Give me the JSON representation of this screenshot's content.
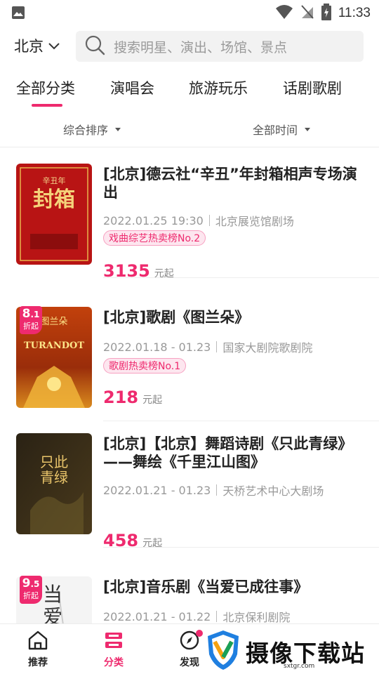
{
  "status_bar": {
    "time": "11:33"
  },
  "header": {
    "city": "北京",
    "search_placeholder": "搜索明星、演出、场馆、景点"
  },
  "tabs": [
    {
      "label": "全部分类",
      "active": true
    },
    {
      "label": "演唱会"
    },
    {
      "label": "旅游玩乐"
    },
    {
      "label": "话剧歌剧"
    }
  ],
  "filters": {
    "sort": "综合排序",
    "time": "全部时间"
  },
  "events": [
    {
      "title": "[北京]德云社“辛丑”年封箱相声专场演出",
      "date": "2022.01.25 19:30",
      "venue": "北京展览馆剧场",
      "tag": "戏曲综艺热卖榜No.2",
      "price": "3135",
      "price_unit": "元起",
      "poster_text": "封箱",
      "poster_sub": "辛丑年"
    },
    {
      "title": "[北京]歌剧《图兰朵》",
      "date": "2022.01.18 - 01.23",
      "venue": "国家大剧院歌剧院",
      "tag": "歌剧热卖榜No.1",
      "price": "218",
      "price_unit": "元起",
      "discount_int": "8",
      "discount_dec": ".1",
      "discount_label": "折起",
      "poster_text": "TURANDOT",
      "poster_sub": "图兰朵"
    },
    {
      "title": "[北京]【北京】舞蹈诗剧《只此青绿》——舞绘《千里江山图》",
      "date": "2022.01.21 - 01.23",
      "venue": "天桥艺术中心大剧场",
      "price": "458",
      "price_unit": "元起",
      "poster_text": "只此青绿"
    },
    {
      "title": "[北京]音乐剧《当爱已成往事》",
      "date": "2022.01.21 - 01.22",
      "venue": "北京保利剧院",
      "discount_int": "9",
      "discount_dec": ".5",
      "discount_label": "折起",
      "poster_text": "当爱"
    }
  ],
  "bottom_nav": [
    {
      "label": "推荐",
      "icon": "home-icon"
    },
    {
      "label": "分类",
      "icon": "category-icon",
      "active": true
    },
    {
      "label": "发现",
      "icon": "compass-icon"
    }
  ],
  "watermark": {
    "text": "摄像下载站",
    "url": "sxtgr.com"
  },
  "colors": {
    "accent": "#ee2a6e",
    "tag_bg": "#fde6ef"
  }
}
